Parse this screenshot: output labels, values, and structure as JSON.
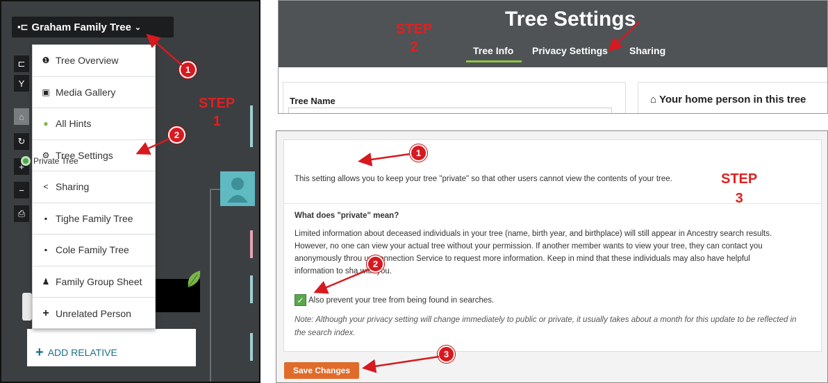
{
  "panel1": {
    "tree_title": "Graham Family Tree",
    "menu": [
      {
        "icon": "info-circle-icon",
        "glyph": "❶",
        "label": "Tree Overview"
      },
      {
        "icon": "image-gallery-icon",
        "glyph": "▣",
        "label": "Media Gallery"
      },
      {
        "icon": "leaf-icon",
        "glyph": "●",
        "label": "All Hints"
      },
      {
        "icon": "gear-icon",
        "glyph": "⚙",
        "label": "Tree Settings"
      },
      {
        "icon": "share-icon",
        "glyph": "<",
        "label": "Sharing"
      },
      {
        "icon": "tree-icon",
        "glyph": "▪",
        "label": "Tighe Family Tree"
      },
      {
        "icon": "tree-icon",
        "glyph": "▪",
        "label": "Cole Family Tree"
      },
      {
        "icon": "group-icon",
        "glyph": "♟",
        "label": "Family Group Sheet"
      },
      {
        "icon": "plus-icon",
        "glyph": "+",
        "label": "Unrelated Person"
      }
    ],
    "add_relative": "ADD RELATIVE",
    "step_label": "STEP",
    "step_number": "1",
    "badges": [
      "1",
      "2"
    ]
  },
  "panel2": {
    "title": "Tree Settings",
    "tabs": [
      "Tree Info",
      "Privacy Settings",
      "Sharing"
    ],
    "active_tab": "Tree Info",
    "step_label": "STEP",
    "step_number": "2",
    "tree_name_label": "Tree Name",
    "home_person_label": "Your home person in this tree",
    "accent": "#8dc63f"
  },
  "panel3": {
    "private_label": "Private Tree",
    "private_desc": "This setting allows you to keep your tree \"private\" so that other users cannot view the contents of your tree.",
    "step_label": "STEP",
    "step_number": "3",
    "what_heading": "What does \"private\" mean?",
    "body_lines": [
      "Limited information about deceased individuals in your tree (name, birth year, and birthplace) will still appear in Ancestry search results.",
      "However, no one can view your actual tree without your permission. If another member wants to view your tree, they can contact you",
      "anonymously throu   ur Connection Service to request more information. Keep in mind that these individuals may also have helpful",
      "information to sha   with you."
    ],
    "checkbox_label": "Also prevent your tree from being found in searches.",
    "checkbox_checked": true,
    "note": "Note: Although your privacy setting will change immediately to public or private, it usually takes about a month for this update to be reflected in the search index.",
    "save_label": "Save Changes",
    "badges": [
      "1",
      "2",
      "3"
    ],
    "save_color": "#e06b2a"
  }
}
